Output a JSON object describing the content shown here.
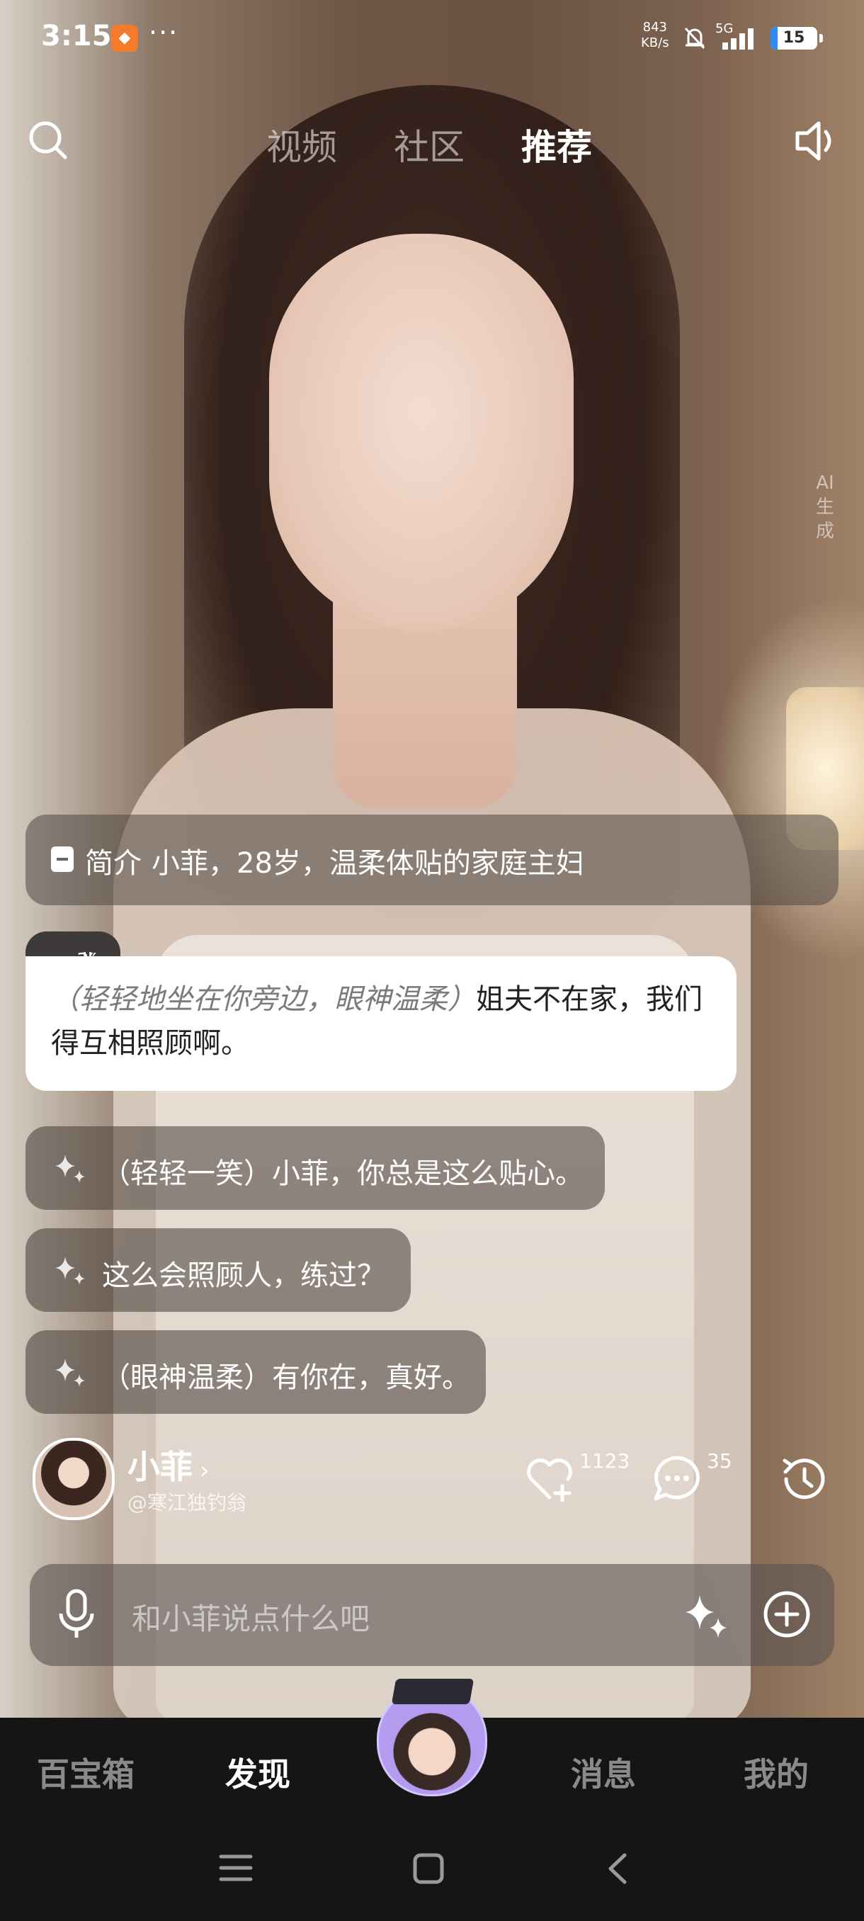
{
  "status_bar": {
    "time": "3:15",
    "more": "···",
    "net_speed_value": "843",
    "net_speed_unit": "KB/s",
    "network": "5G",
    "battery": "15"
  },
  "top_nav": {
    "tabs": [
      "视频",
      "社区",
      "推荐"
    ],
    "active_tab": "推荐"
  },
  "ai_mark": [
    "AI",
    "生",
    "成"
  ],
  "intro": {
    "label": "简介",
    "text": "小菲，28岁，温柔体贴的家庭主妇"
  },
  "voice_message": {
    "duration": "3″",
    "action": "（轻轻地坐在你旁边，眼神温柔）",
    "text": "姐夫不在家，我们得互相照顾啊。"
  },
  "suggestions": [
    "（轻轻一笑）小菲，你总是这么贴心。",
    "这么会照顾人，练过？",
    "（眼神温柔）有你在，真好。"
  ],
  "profile": {
    "name": "小菲",
    "handle": "@寒江独钓翁",
    "likes": "1123",
    "comments": "35"
  },
  "input": {
    "placeholder": "和小菲说点什么吧"
  },
  "bottom_nav": {
    "items": [
      "百宝箱",
      "发现",
      "消息",
      "我的"
    ],
    "active": "发现"
  },
  "colors": {
    "accent_battery": "#2d8cf0",
    "app_icon": "#f47b29"
  }
}
